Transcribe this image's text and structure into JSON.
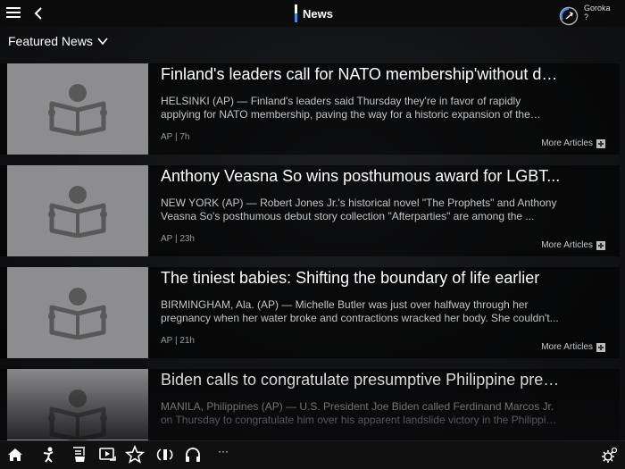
{
  "header": {
    "title": "News",
    "user": {
      "name": "Goroka",
      "status": "?"
    }
  },
  "section": {
    "label": "Featured News"
  },
  "articles": [
    {
      "title": "Finland's leaders call for NATO membership'without del...",
      "summary": "HELSINKI (AP) — Finland's leaders said Thursday they're in favor of rapidly applying for NATO membership, paving the way for a historic expansion of the alliance that...",
      "meta": "AP | 7h",
      "more_label": "More Articles"
    },
    {
      "title": "Anthony Veasna So wins posthumous award for LGBT...",
      "summary": "NEW YORK (AP) — Robert Jones Jr.'s historical novel \"The Prophets\" and Anthony Veasna So's posthumous debut story collection \"Afterparties\" are among the ...",
      "meta": "AP | 23h",
      "more_label": "More Articles"
    },
    {
      "title": "The tiniest babies: Shifting the boundary of life earlier",
      "summary": "BIRMINGHAM, Ala. (AP) — Michelle Butler was just over halfway through her pregnancy when her water broke and contractions wracked her body. She couldn't...",
      "meta": "AP | 21h",
      "more_label": "More Articles"
    },
    {
      "title": "Biden calls to congratulate presumptive Philippine presi...",
      "summary": "MANILA, Philippines (AP) — U.S. President Joe Biden called Ferdinand Marcos Jr. on Thursday to congratulate him over his apparent landslide victory in the Philippine ...",
      "meta": "",
      "more_label": ""
    }
  ],
  "bottom_nav": {
    "items": [
      "home-icon",
      "person-icon",
      "menu-card-icon",
      "video-icon",
      "star-icon",
      "audio-icon",
      "headphones-icon",
      "settings-icon"
    ],
    "more_label": "···"
  },
  "colors": {
    "accent": "#2f8cff",
    "background": "#0c0c0e"
  }
}
